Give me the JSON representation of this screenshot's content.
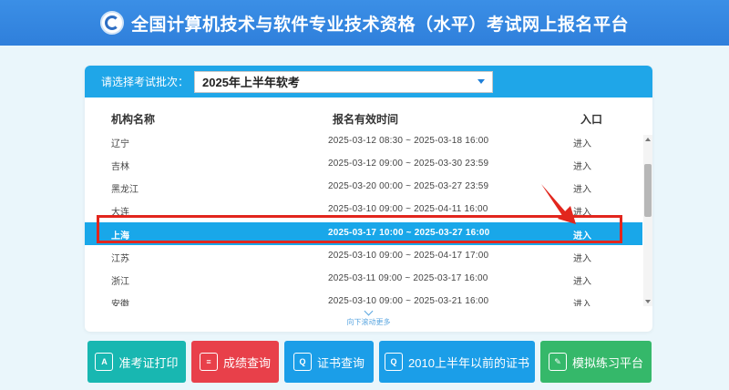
{
  "header": {
    "title": "全国计算机技术与软件专业技术资格（水平）考试网上报名平台"
  },
  "selector": {
    "label": "请选择考试批次：",
    "value": "2025年上半年软考"
  },
  "table": {
    "columns": [
      "机构名称",
      "报名有效时间",
      "入口"
    ],
    "rows": [
      {
        "name": "辽宁",
        "time": "2025-03-12 08:30 ~ 2025-03-18 16:00",
        "entry": "进入"
      },
      {
        "name": "吉林",
        "time": "2025-03-12 09:00 ~ 2025-03-30 23:59",
        "entry": "进入"
      },
      {
        "name": "黑龙江",
        "time": "2025-03-20 00:00 ~ 2025-03-27 23:59",
        "entry": "进入"
      },
      {
        "name": "大连",
        "time": "2025-03-10 09:00 ~ 2025-04-11 16:00",
        "entry": "进入"
      },
      {
        "name": "上海",
        "time": "2025-03-17 10:00 ~ 2025-03-27 16:00",
        "entry": "进入"
      },
      {
        "name": "江苏",
        "time": "2025-03-10 09:00 ~ 2025-04-17 17:00",
        "entry": "进入"
      },
      {
        "name": "浙江",
        "time": "2025-03-11 09:00 ~ 2025-03-17 16:00",
        "entry": "进入"
      },
      {
        "name": "安徽",
        "time": "2025-03-10 09:00 ~ 2025-03-21 16:00",
        "entry": "进入"
      }
    ],
    "selected_row": "上海",
    "more_hint": "向下滚动更多"
  },
  "buttons": [
    {
      "label": "准考证打印",
      "icon": "id-card-icon",
      "glyph": "A",
      "color": "#18b7b1"
    },
    {
      "label": "成绩查询",
      "icon": "score-report-icon",
      "glyph": "≡",
      "color": "#e8404a"
    },
    {
      "label": "证书查询",
      "icon": "certificate-icon",
      "glyph": "Q",
      "color": "#1b9ee8"
    },
    {
      "label": "2010上半年以前的证书",
      "icon": "old-certificate-icon",
      "glyph": "Q",
      "color": "#1b9ee8"
    },
    {
      "label": "模拟练习平台",
      "icon": "practice-icon",
      "glyph": "✎",
      "color": "#35b86a"
    }
  ],
  "colors": {
    "header": "#2f7fdb",
    "accent": "#1fa6e8",
    "highlight": "#e2261d"
  }
}
